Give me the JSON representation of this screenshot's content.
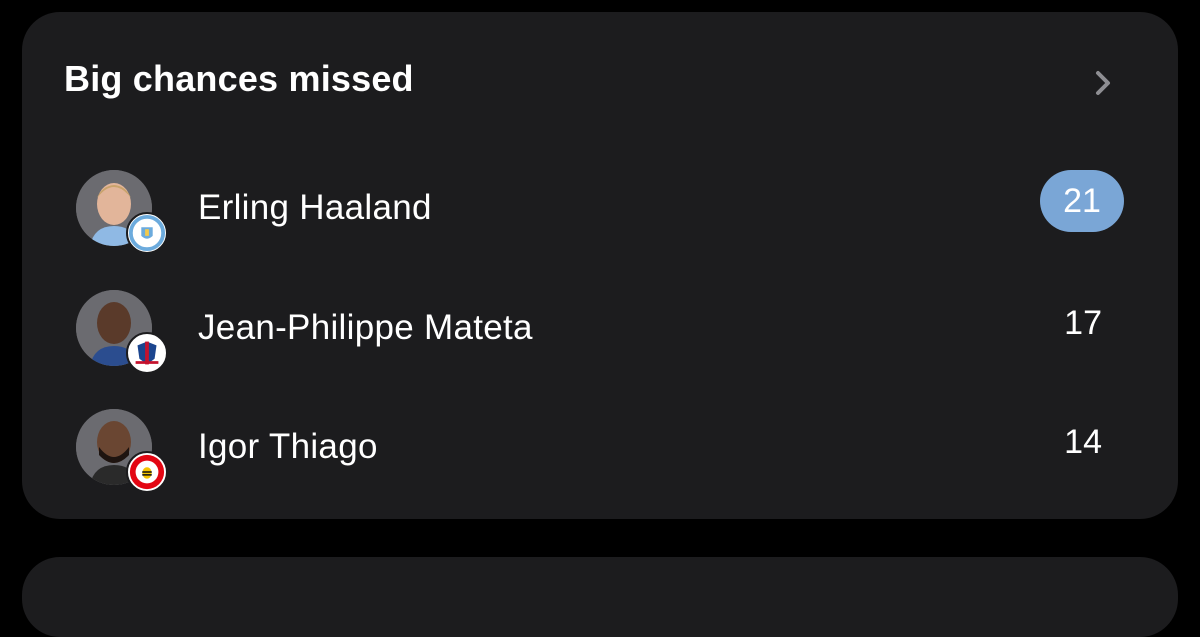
{
  "card": {
    "title": "Big chances missed"
  },
  "players": [
    {
      "name": "Erling Haaland",
      "value": "21",
      "highlighted": true,
      "club_badge": "manchester-city-badge",
      "badge_color": "#6cabdd"
    },
    {
      "name": "Jean-Philippe Mateta",
      "value": "17",
      "highlighted": false,
      "club_badge": "crystal-palace-badge",
      "badge_color": "#1b458f"
    },
    {
      "name": "Igor Thiago",
      "value": "14",
      "highlighted": false,
      "club_badge": "brentford-badge",
      "badge_color": "#e30613"
    }
  ],
  "colors": {
    "background": "#000000",
    "card": "#1c1c1e",
    "highlight": "#7aa6d6",
    "text": "#ffffff",
    "chevron": "#8e8e93"
  }
}
